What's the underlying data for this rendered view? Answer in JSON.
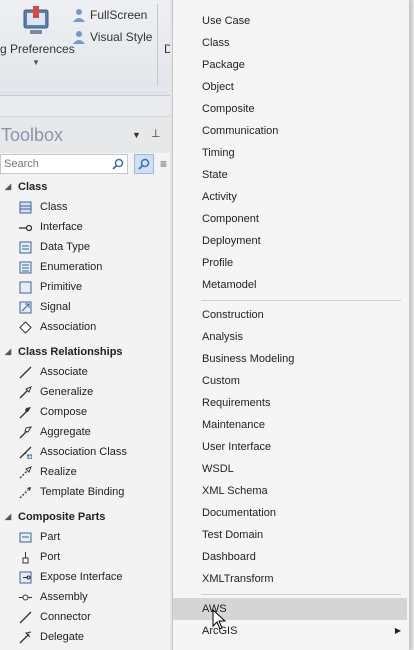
{
  "ribbon": {
    "preferences_label": "g Preferences",
    "fullscreen_label": "FullScreen",
    "visual_style_label": "Visual Style",
    "partial_d": "D"
  },
  "toolbox": {
    "title": "Toolbox",
    "search_placeholder": "Search",
    "groups": [
      {
        "label": "Class",
        "items": [
          "Class",
          "Interface",
          "Data Type",
          "Enumeration",
          "Primitive",
          "Signal",
          "Association"
        ]
      },
      {
        "label": "Class Relationships",
        "items": [
          "Associate",
          "Generalize",
          "Compose",
          "Aggregate",
          "Association Class",
          "Realize",
          "Template Binding"
        ]
      },
      {
        "label": "Composite Parts",
        "items": [
          "Part",
          "Port",
          "Expose Interface",
          "Assembly",
          "Connector",
          "Delegate"
        ]
      }
    ]
  },
  "menu": {
    "section1": [
      "Use Case",
      "Class",
      "Package",
      "Object",
      "Composite",
      "Communication",
      "Timing",
      "State",
      "Activity",
      "Component",
      "Deployment",
      "Profile",
      "Metamodel"
    ],
    "section2": [
      "Construction",
      "Analysis",
      "Business Modeling",
      "Custom",
      "Requirements",
      "Maintenance",
      "User Interface",
      "WSDL",
      "XML Schema",
      "Documentation",
      "Test Domain",
      "Dashboard",
      "XMLTransform"
    ],
    "section3": [
      "AWS",
      "ArcGIS"
    ],
    "hovered": "AWS",
    "submenu_item": "ArcGIS"
  },
  "colors": {
    "menu_bg": "#f5f5f5",
    "hover_bg": "#d5d5d5",
    "toolbox_title": "#8a96a8"
  }
}
